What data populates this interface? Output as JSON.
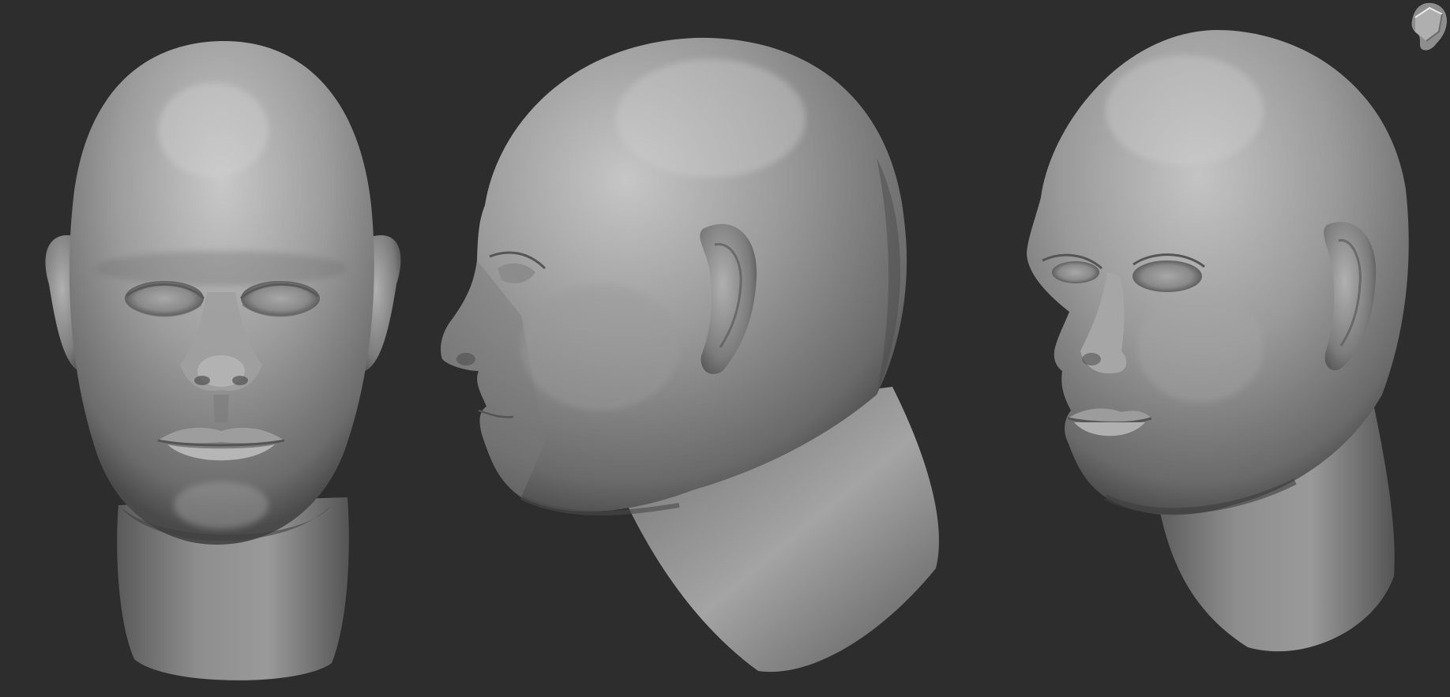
{
  "canvas": {
    "background_color": "#2d2d2d",
    "material_base_color": "#8c8c8c",
    "material_highlight_color": "#c4c4c4",
    "material_shadow_color": "#4a4a4a"
  },
  "views": [
    {
      "name": "front-view",
      "icon": "head-sculpt-front"
    },
    {
      "name": "side-view",
      "icon": "head-sculpt-profile-left"
    },
    {
      "name": "three-quarter-view",
      "icon": "head-sculpt-three-quarter"
    }
  ],
  "orientation_widget": {
    "icon": "head-orientation-gizmo"
  }
}
